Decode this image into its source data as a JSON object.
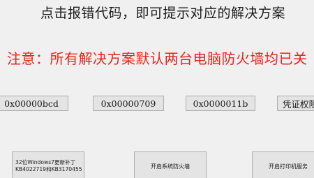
{
  "headline": "点击报错代码，即可提示对应的解决方案",
  "notice": "注意：所有解决方案默认两台电脑防火墙均已关",
  "error_buttons": {
    "bcd": "0x00000bcd",
    "e709": "0x00000709",
    "e11b": "0x0000011b",
    "credentials": "凭证权限"
  },
  "action_buttons": {
    "win7_line1": "32位Windows7更新补丁",
    "win7_line2": "KB4022719和KB3170455",
    "firewall": "开启系统防火墙",
    "printer": "开启打印机服务"
  },
  "colors": {
    "notice_text": "#e8251d",
    "background": "#f0f0f0"
  }
}
